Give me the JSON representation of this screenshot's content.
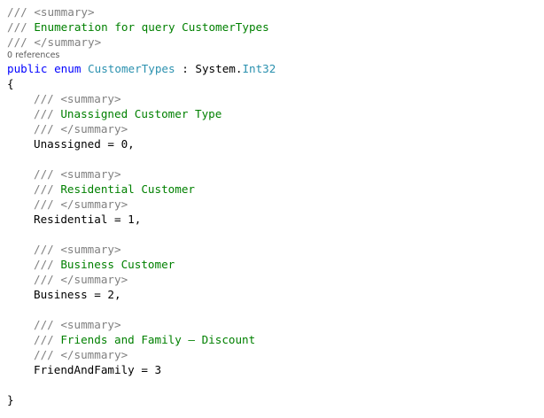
{
  "code": {
    "header_comment": {
      "open_tag": "/// <summary>",
      "text": "Enumeration for query CustomerTypes",
      "close_tag": "/// </summary>"
    },
    "codelens": "0 references",
    "declaration": {
      "kw_public": "public",
      "kw_enum": "enum",
      "name": "CustomerTypes",
      "colon": " : ",
      "base_ns": "System.",
      "base_type": "Int32"
    },
    "open_brace": "{",
    "close_brace": "}",
    "doc_prefix": "/// ",
    "members": [
      {
        "open_tag": "/// <summary>",
        "text": "Unassigned Customer Type",
        "close_tag": "/// </summary>",
        "code": "Unassigned = 0,"
      },
      {
        "open_tag": "/// <summary>",
        "text": "Residential Customer",
        "close_tag": "/// </summary>",
        "code": "Residential = 1,"
      },
      {
        "open_tag": "/// <summary>",
        "text": "Business Customer",
        "close_tag": "/// </summary>",
        "code": "Business = 2,"
      },
      {
        "open_tag": "/// <summary>",
        "text": "Friends and Family – Discount",
        "close_tag": "/// </summary>",
        "code": "FriendAndFamily = 3"
      }
    ]
  }
}
